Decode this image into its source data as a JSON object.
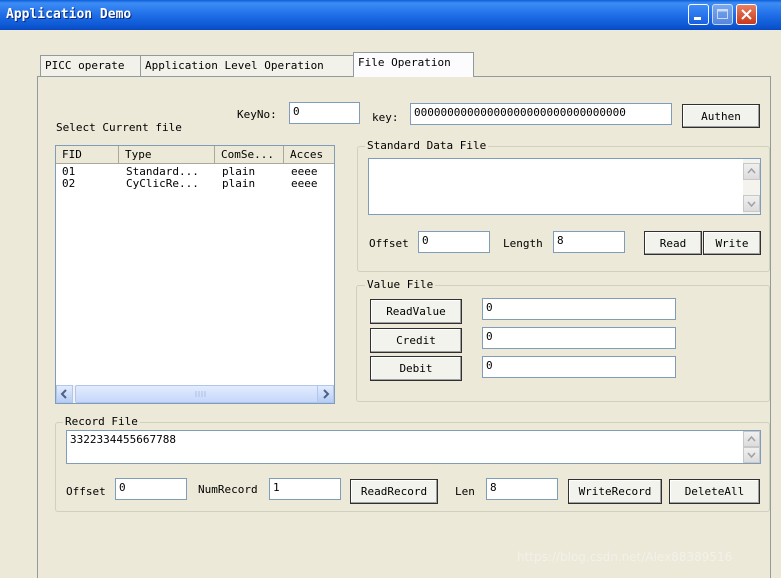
{
  "window": {
    "title": "Application Demo"
  },
  "tabs": [
    {
      "label": "PICC operate"
    },
    {
      "label": "Application Level Operation"
    },
    {
      "label": "File Operation"
    }
  ],
  "select_file": {
    "label": "Select Current file",
    "keyno_label": "KeyNo:",
    "keyno_value": "0",
    "columns": [
      "FID",
      "Type",
      "ComSe...",
      "Acces"
    ],
    "rows": [
      [
        "01",
        "Standard...",
        "plain",
        "eeee"
      ],
      [
        "02",
        "CyClicRe...",
        "plain",
        "eeee"
      ]
    ]
  },
  "auth": {
    "key_label": "key:",
    "key_value": "00000000000000000000000000000000",
    "authen_label": "Authen"
  },
  "standard_data_file": {
    "title": "Standard Data File",
    "content": "",
    "offset_label": "Offset",
    "offset_value": "0",
    "length_label": "Length",
    "length_value": "8",
    "read_label": "Read",
    "write_label": "Write"
  },
  "value_file": {
    "title": "Value File",
    "readvalue_label": "ReadValue",
    "readvalue_value": "0",
    "credit_label": "Credit",
    "credit_value": "0",
    "debit_label": "Debit",
    "debit_value": "0"
  },
  "record_file": {
    "title": "Record File",
    "content": "3322334455667788",
    "offset_label": "Offset",
    "offset_value": "0",
    "numrecord_label": "NumRecord",
    "numrecord_value": "1",
    "readrecord_label": "ReadRecord",
    "len_label": "Len",
    "len_value": "8",
    "writerecord_label": "WriteRecord",
    "deleteall_label": "DeleteAll"
  },
  "watermark": "https://blog.csdn.net/Alex88389516"
}
